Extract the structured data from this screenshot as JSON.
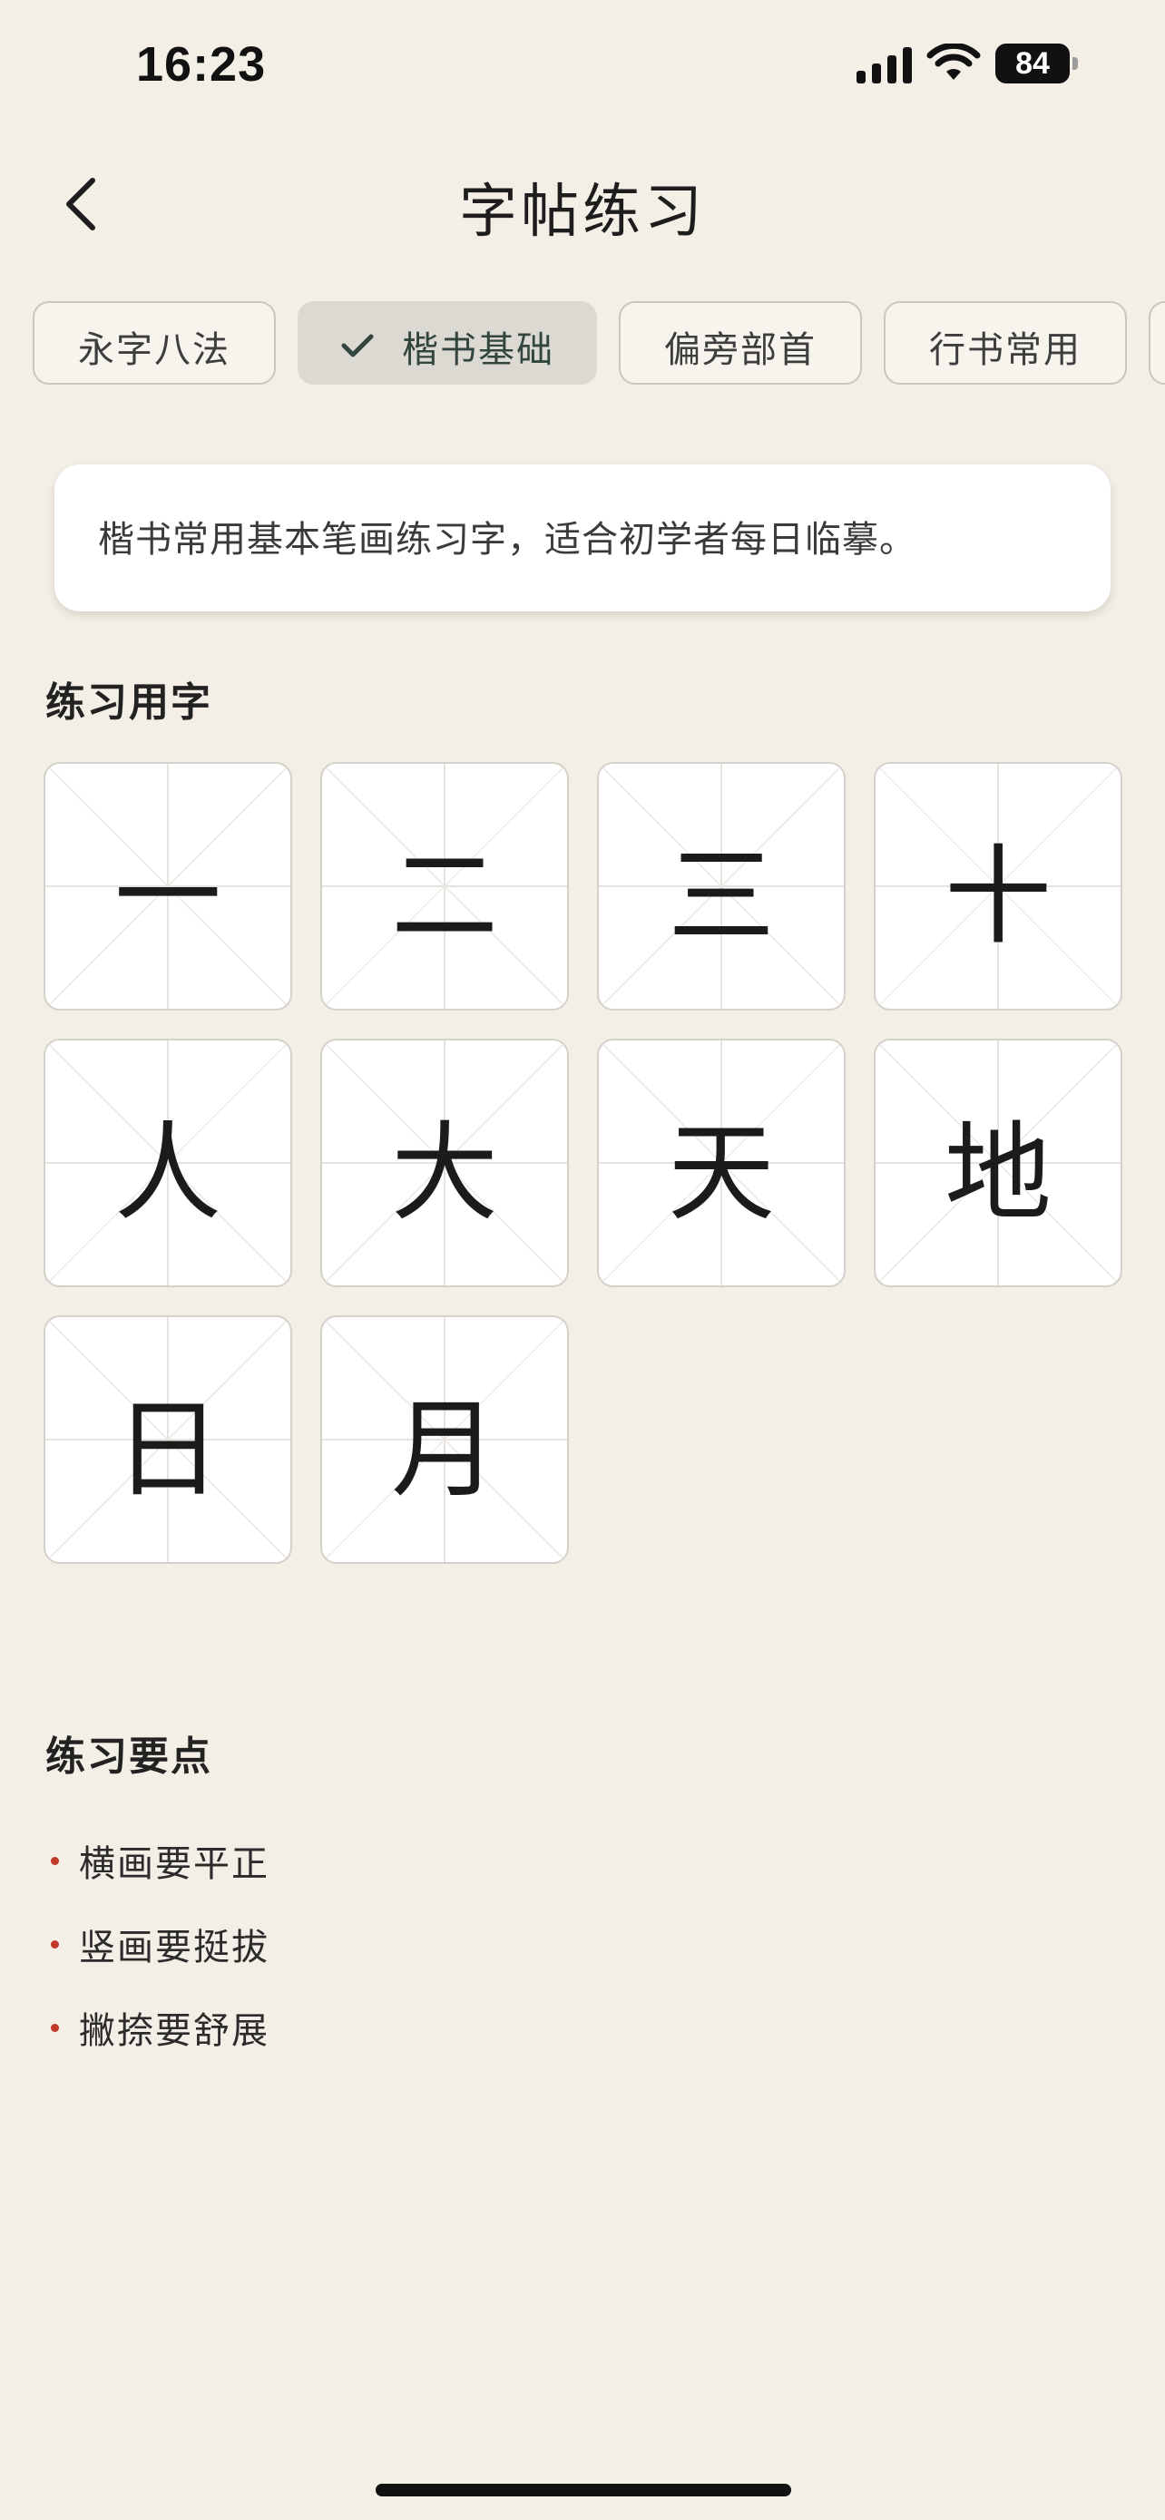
{
  "status": {
    "time": "16:23",
    "battery": "84",
    "icons": [
      "signal-icon",
      "wifi-icon",
      "battery-icon"
    ]
  },
  "header": {
    "title": "字帖练习",
    "back_icon": "chevron-left-icon"
  },
  "tabs": [
    {
      "label": "永字八法",
      "selected": false
    },
    {
      "label": "楷书基础",
      "selected": true
    },
    {
      "label": "偏旁部首",
      "selected": false
    },
    {
      "label": "行书常用",
      "selected": false
    }
  ],
  "description": "楷书常用基本笔画练习字，适合初学者每日临摹。",
  "characters_section": {
    "title": "练习用字",
    "characters": [
      "一",
      "二",
      "三",
      "十",
      "人",
      "大",
      "天",
      "地",
      "日",
      "月"
    ]
  },
  "tips_section": {
    "title": "练习要点",
    "items": [
      "横画要平正",
      "竖画要挺拔",
      "撇捺要舒展"
    ]
  },
  "colors": {
    "background": "#f3efe6",
    "selected_tab": "#dcd9d3",
    "bullet": "#c0392b"
  }
}
